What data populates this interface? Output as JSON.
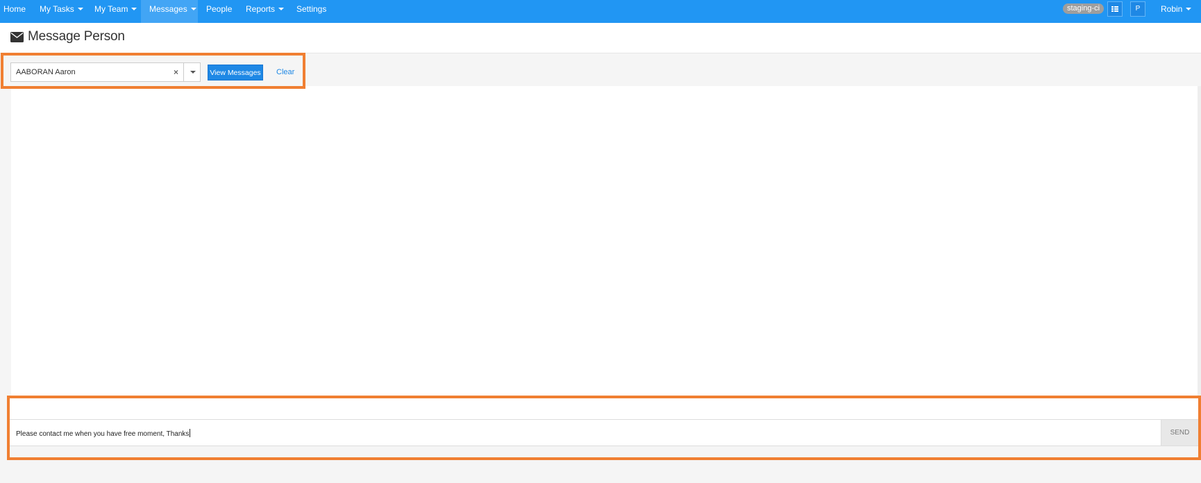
{
  "nav": {
    "home": "Home",
    "my_tasks": "My Tasks",
    "my_team": "My Team",
    "messages": "Messages",
    "people": "People",
    "reports": "Reports",
    "settings": "Settings",
    "env_badge": "staging-ci",
    "apps_icon": "grid-icon",
    "profile_initial": "P",
    "user_name": "Robin"
  },
  "page": {
    "title": "Message Person",
    "title_icon": "envelope-icon"
  },
  "selector": {
    "selected_person": "AABORAN Aaron",
    "view_button": "View Messages",
    "clear_link": "Clear"
  },
  "composer": {
    "message_text": "Please contact me when you have free moment, Thanks",
    "send_button": "SEND"
  },
  "colors": {
    "nav_bg": "#2196f3",
    "accent": "#1e88e5",
    "highlight": "#f07f32"
  }
}
